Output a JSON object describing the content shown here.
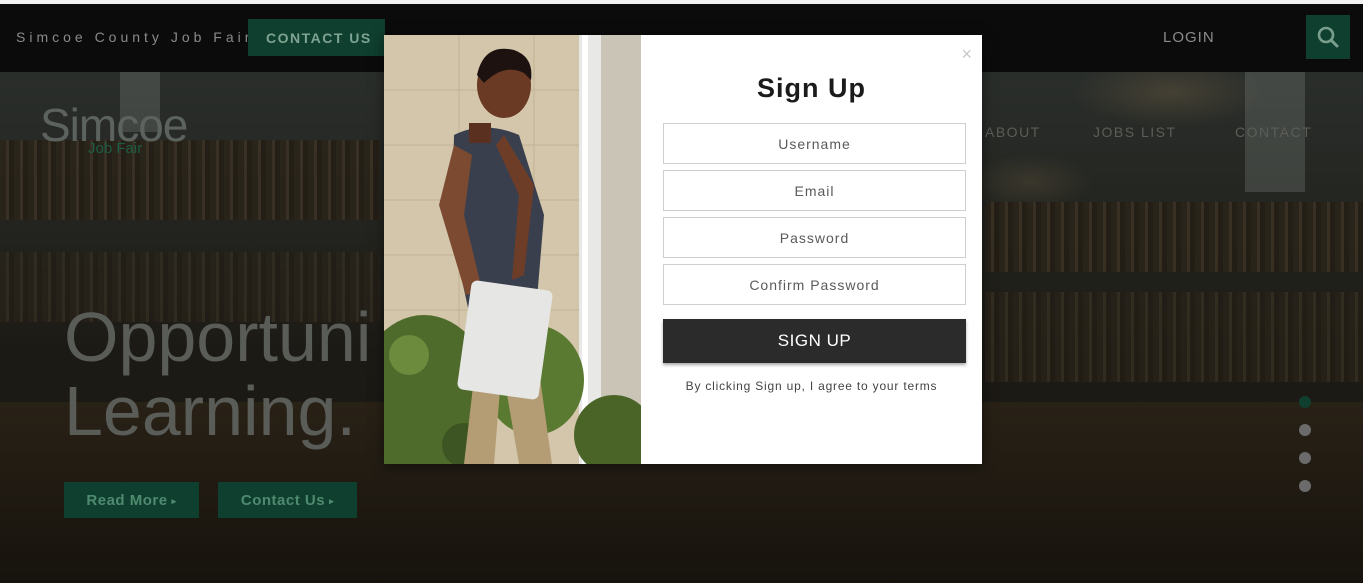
{
  "header": {
    "site_name": "Simcoe County Job Fair",
    "contact_label": "CONTACT US",
    "login_label": "LOGIN",
    "search_icon": "search-icon"
  },
  "hero": {
    "logo_main": "Simcoe",
    "logo_sub": "Job Fair",
    "nav": [
      "ABOUT",
      "JOBS LIST",
      "CONTACT"
    ],
    "headline_line1": "Opportuni",
    "headline_line2": "Learning.",
    "buttons": [
      "Read More",
      "Contact Us"
    ],
    "caret_icon": "▸",
    "carousel": {
      "count": 4,
      "active": 1
    }
  },
  "modal": {
    "close_label": "×",
    "title": "Sign Up",
    "fields": {
      "username": "Username",
      "email": "Email",
      "password": "Password",
      "confirm_password": "Confirm Password"
    },
    "submit_label": "SIGN UP",
    "terms": "By clicking Sign up, I agree to your terms"
  },
  "colors": {
    "brand_green": "#0f3f2e",
    "button_dark": "#2b2b2b"
  }
}
